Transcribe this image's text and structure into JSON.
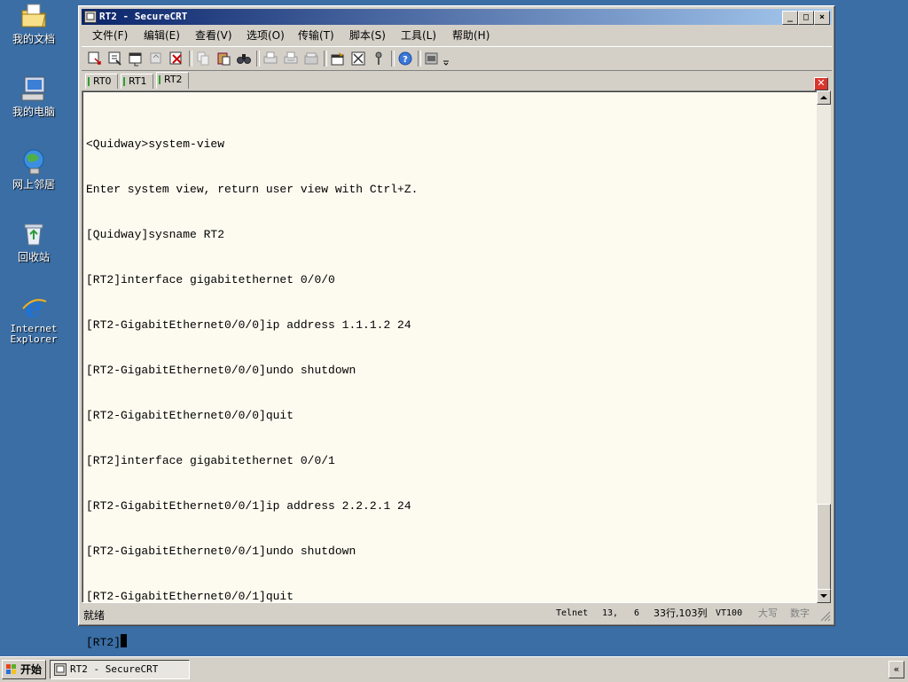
{
  "desktop": {
    "icons": [
      {
        "label": "我的文档",
        "icon": "my-documents-icon"
      },
      {
        "label": "我的电脑",
        "icon": "my-computer-icon"
      },
      {
        "label": "网上邻居",
        "icon": "network-places-icon"
      },
      {
        "label": "回收站",
        "icon": "recycle-bin-icon"
      },
      {
        "label": "Internet\nExplorer",
        "icon": "internet-explorer-icon"
      }
    ]
  },
  "window": {
    "title": "RT2 - SecureCRT",
    "title_buttons": {
      "minimize": "_",
      "maximize": "□",
      "close": "×"
    }
  },
  "menu": {
    "items": [
      "文件(F)",
      "编辑(E)",
      "查看(V)",
      "选项(O)",
      "传输(T)",
      "脚本(S)",
      "工具(L)",
      "帮助(H)"
    ]
  },
  "toolbar": {
    "icons": [
      "connect-icon",
      "quick-connect-icon",
      "connect-tab-icon",
      "reconnect-icon",
      "disconnect-icon",
      "copy-icon",
      "paste-icon",
      "find-icon",
      "print-icon",
      "print-selection-icon",
      "print-setup-icon",
      "session-options-icon",
      "global-options-icon",
      "keymap-icon",
      "help-icon",
      "sftp-icon",
      "toolbar-dropdown-icon"
    ]
  },
  "tabs": {
    "items": [
      {
        "label": "RT0",
        "active": false
      },
      {
        "label": "RT1",
        "active": false
      },
      {
        "label": "RT2",
        "active": true
      }
    ],
    "close_label": "✕"
  },
  "terminal": {
    "lines": [
      "<Quidway>system-view",
      "Enter system view, return user view with Ctrl+Z.",
      "[Quidway]sysname RT2",
      "[RT2]interface gigabitethernet 0/0/0",
      "[RT2-GigabitEthernet0/0/0]ip address 1.1.1.2 24",
      "[RT2-GigabitEthernet0/0/0]undo shutdown",
      "[RT2-GigabitEthernet0/0/0]quit",
      "[RT2]interface gigabitethernet 0/0/1",
      "[RT2-GigabitEthernet0/0/1]ip address 2.2.2.1 24",
      "[RT2-GigabitEthernet0/0/1]undo shutdown",
      "[RT2-GigabitEthernet0/0/1]quit"
    ],
    "prompt": "[RT2]"
  },
  "status": {
    "ready": "就绪",
    "protocol": "Telnet",
    "row": "13,",
    "col": "6",
    "size": "33行,103列",
    "emulation": "VT100",
    "caps": "大写",
    "num": "数字"
  },
  "taskbar": {
    "start_label": "开始",
    "task_label": "RT2 - SecureCRT",
    "tray_label": "«"
  },
  "colors": {
    "desktop": "#3a6ea5",
    "titlebar_start": "#0a246a",
    "titlebar_end": "#a6caf0",
    "terminal_bg": "#fdfbf0",
    "tab_marker": "#2fa02f",
    "tab_close": "#d9362c"
  }
}
